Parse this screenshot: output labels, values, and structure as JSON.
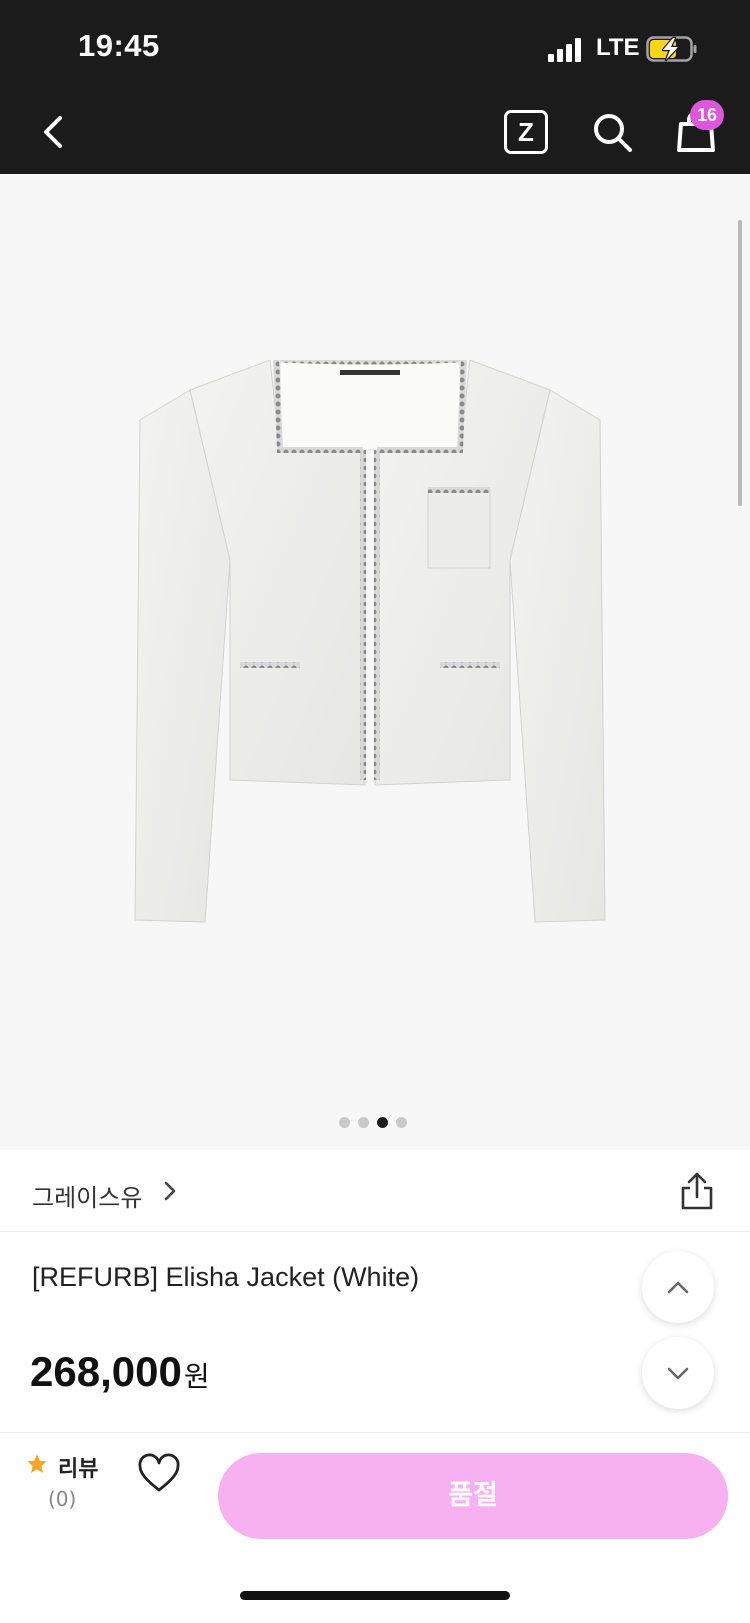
{
  "status_bar": {
    "time": "19:45",
    "network": "LTE",
    "icons": [
      "signal-icon",
      "battery-charging-icon"
    ]
  },
  "nav": {
    "back_icon": "chevron-left-icon",
    "z_label": "Z",
    "search_icon": "search-icon",
    "bag_icon": "shopping-bag-icon",
    "bag_count": "16"
  },
  "gallery": {
    "image": "white tweed jacket with embellished trim",
    "slide_count": 4,
    "active_slide": 3
  },
  "brand": {
    "name": "그레이스유",
    "chevron_icon": "chevron-right-icon",
    "share_icon": "share-icon"
  },
  "product": {
    "title": "[REFURB] Elisha Jacket (White)",
    "price": "268,000",
    "currency": "원"
  },
  "float_buttons": {
    "up_icon": "chevron-up-icon",
    "down_icon": "chevron-down-icon"
  },
  "bottom_bar": {
    "review_label": "리뷰",
    "review_count": "(0)",
    "star_icon": "star-icon",
    "like_icon": "heart-icon",
    "cta_label": "품절"
  },
  "colors": {
    "topbar": "#1b1b1b",
    "badge": "#e055dd",
    "cta": "#f7b0f0",
    "star": "#f5a623"
  }
}
